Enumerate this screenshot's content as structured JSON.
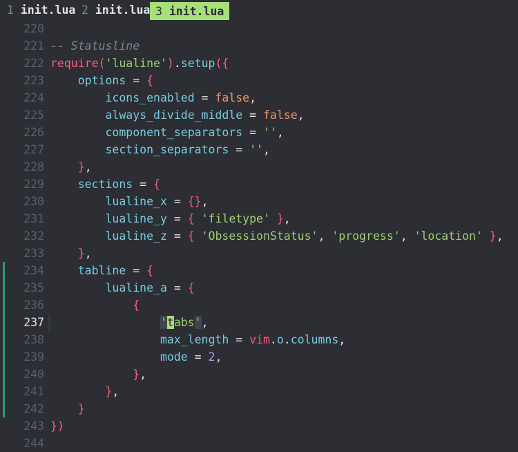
{
  "tabs": [
    {
      "num": "1",
      "name": "init.lua",
      "active": false
    },
    {
      "num": "2",
      "name": "init.lua",
      "active": false
    },
    {
      "num": "3",
      "name": "init.lua",
      "active": true
    }
  ],
  "lines": [
    {
      "n": "220",
      "t": ""
    },
    {
      "n": "221",
      "t": "-- Statusline"
    },
    {
      "n": "222",
      "t": "require('lualine').setup({"
    },
    {
      "n": "223",
      "t": "    options = {"
    },
    {
      "n": "224",
      "t": "        icons_enabled = false,"
    },
    {
      "n": "225",
      "t": "        always_divide_middle = false,"
    },
    {
      "n": "226",
      "t": "        component_separators = '',"
    },
    {
      "n": "227",
      "t": "        section_separators = '',"
    },
    {
      "n": "228",
      "t": "    },"
    },
    {
      "n": "229",
      "t": "    sections = {"
    },
    {
      "n": "230",
      "t": "        lualine_x = {},"
    },
    {
      "n": "231",
      "t": "        lualine_y = { 'filetype' },"
    },
    {
      "n": "232",
      "t": "        lualine_z = { 'ObsessionStatus', 'progress', 'location' },"
    },
    {
      "n": "233",
      "t": "    },"
    },
    {
      "n": "234",
      "t": "    tabline = {"
    },
    {
      "n": "235",
      "t": "        lualine_a = {"
    },
    {
      "n": "236",
      "t": "            {"
    },
    {
      "n": "237",
      "t": "                'tabs',"
    },
    {
      "n": "238",
      "t": "                max_length = vim.o.columns,"
    },
    {
      "n": "239",
      "t": "                mode = 2,"
    },
    {
      "n": "240",
      "t": "            },"
    },
    {
      "n": "241",
      "t": "        },"
    },
    {
      "n": "242",
      "t": "    }"
    },
    {
      "n": "243",
      "t": "})"
    },
    {
      "n": "244",
      "t": ""
    }
  ],
  "cursor_line": "237",
  "git_signs_lines": [
    "234",
    "235",
    "236",
    "237",
    "238",
    "239",
    "240",
    "241",
    "242"
  ],
  "colors": {
    "background": "#2c2e34",
    "active_tab": "#a7df78",
    "keyword": "#fc5d7c",
    "function": "#76cce0",
    "string": "#9ed072",
    "boolean": "#f39660",
    "number": "#b39df3",
    "comment": "#7f8490",
    "git_sign": "#2a9d6e"
  }
}
